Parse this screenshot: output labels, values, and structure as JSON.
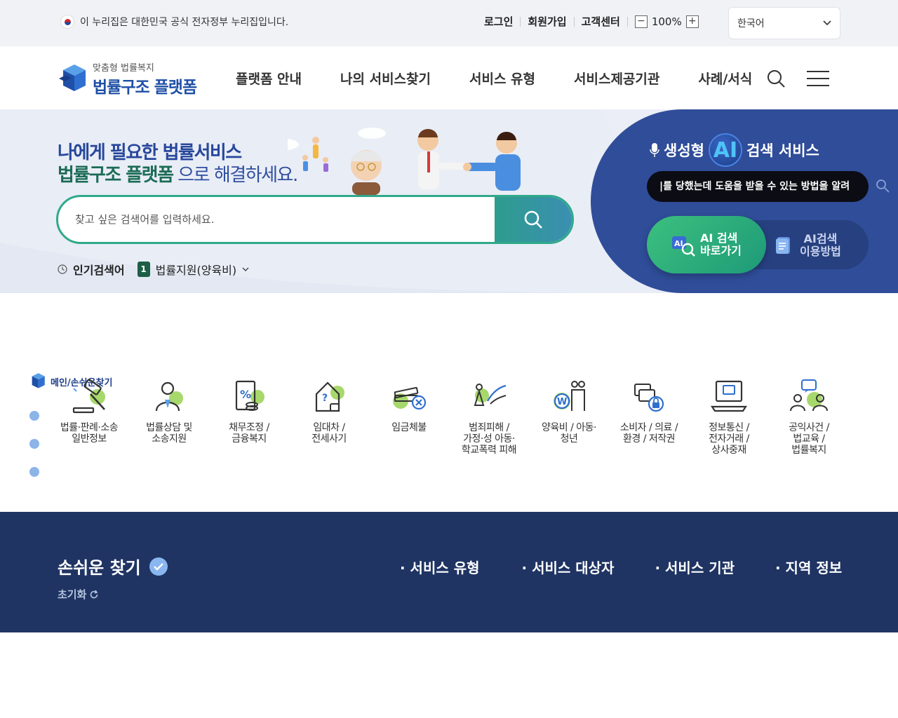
{
  "util": {
    "gov_notice": "이 누리집은 대한민국 공식 전자정부 누리집입니다.",
    "login": "로그인",
    "signup": "회원가입",
    "support": "고객센터",
    "zoom_minus": "−",
    "zoom_level": "100%",
    "zoom_plus": "+",
    "language": "한국어"
  },
  "header": {
    "logo_sub": "맞춤형 법률복지",
    "logo_main": "법률구조 플랫폼",
    "menu": [
      "플랫폼 안내",
      "나의 서비스찾기",
      "서비스 유형",
      "서비스제공기관",
      "사례/서식"
    ]
  },
  "hero": {
    "headline_1": "나에게 필요한 법률서비스",
    "headline_2a": "법률구조 플랫폼",
    "headline_2b": " 으로 해결하세요.",
    "search_placeholder": "찾고 싶은 검색어를 입력하세요.",
    "popular_label": "인기검색어",
    "popular_rank": "1",
    "popular_keyword": "법률지원(양육비)"
  },
  "ai": {
    "title_a": "생성형",
    "logo": "AI",
    "title_b": "검색 서비스",
    "input_value": "|를 당했는데 도움을 받을 수 있는 방법을 알려",
    "btn_search": "AI 검색\n바로가기",
    "btn_guide": "AI검색\n이용방법"
  },
  "categories": {
    "tag": "메인/손쉬운찾기",
    "items": [
      {
        "label": "법률·판례·소송\n일반정보",
        "icon": "gavel-icon"
      },
      {
        "label": "법률상담 및\n소송지원",
        "icon": "counselor-icon"
      },
      {
        "label": "채무조정 /\n금융복지",
        "icon": "debt-document-icon"
      },
      {
        "label": "임대차 /\n전세사기",
        "icon": "house-lock-icon"
      },
      {
        "label": "임금체불",
        "icon": "money-stack-icon"
      },
      {
        "label": "범죄피해 /\n가정·성 아동·\n학교폭력 피해",
        "icon": "victim-support-icon"
      },
      {
        "label": "양육비 / 아동·\n청년",
        "icon": "family-won-icon"
      },
      {
        "label": "소비자 / 의료 /\n환경 / 저작권",
        "icon": "consumer-lock-icon"
      },
      {
        "label": "정보통신 /\n전자거래 /\n상사중재",
        "icon": "laptop-icon"
      },
      {
        "label": "공익사건 /\n법교육 /\n법률복지",
        "icon": "community-chat-icon"
      }
    ]
  },
  "band": {
    "title": "손쉬운 찾기",
    "reset": "초기화",
    "nav": [
      "· 서비스 유형",
      "· 서비스 대상자",
      "· 서비스 기관",
      "· 지역 정보"
    ]
  },
  "colors": {
    "brand_blue": "#1f4fa6",
    "brand_green": "#2fa98a",
    "ai_panel": "#2f4d99",
    "band_bg": "#1f3463"
  }
}
